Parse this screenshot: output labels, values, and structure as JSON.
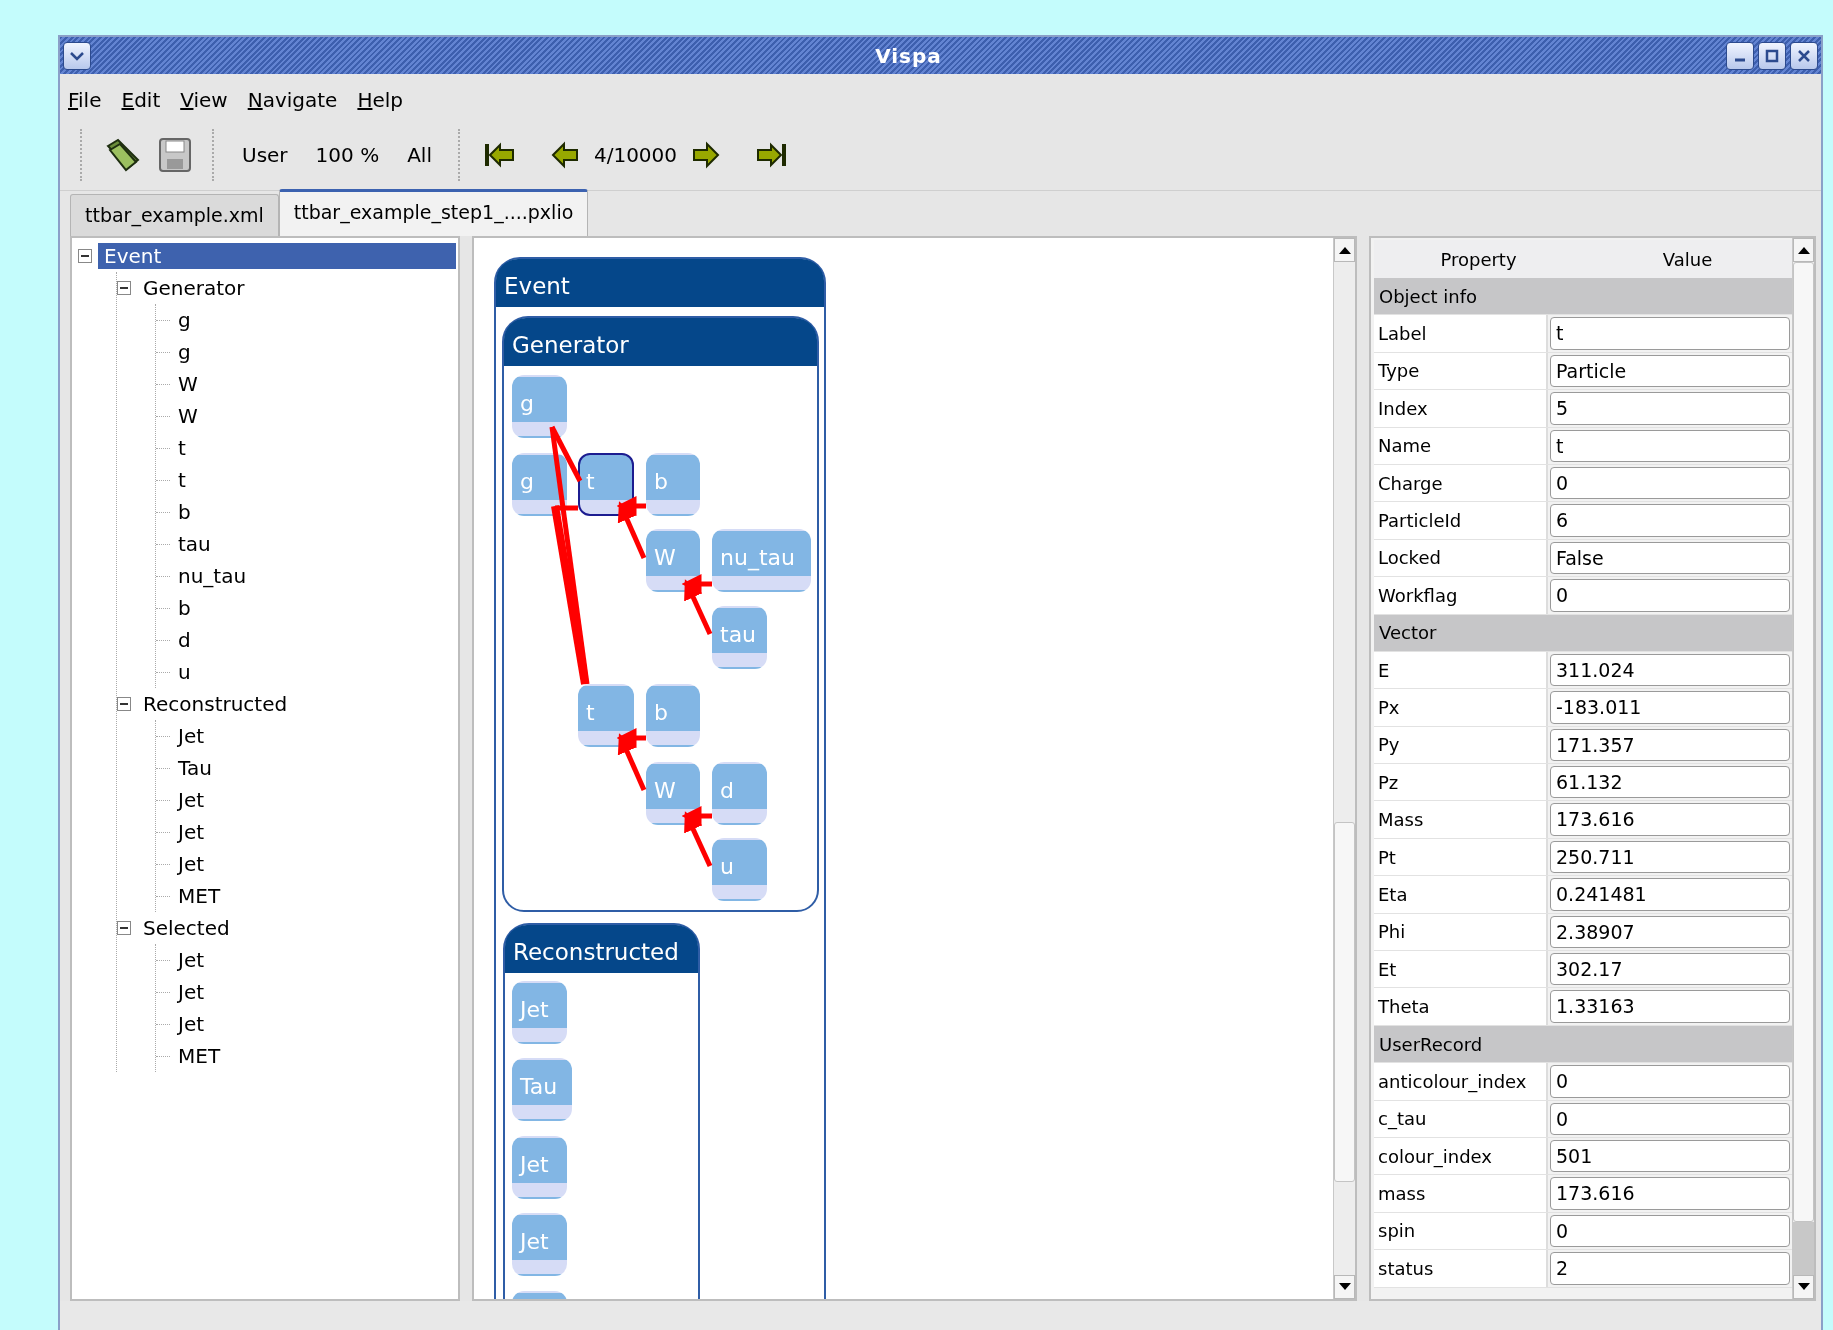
{
  "window": {
    "title": "Vispa"
  },
  "menu": [
    {
      "label": "File"
    },
    {
      "label": "Edit"
    },
    {
      "label": "View"
    },
    {
      "label": "Navigate"
    },
    {
      "label": "Help"
    }
  ],
  "toolbar": {
    "view_mode": "User",
    "zoom": "100 %",
    "filter": "All",
    "event_counter": "4/10000"
  },
  "tabs": [
    {
      "label": "ttbar_example.xml",
      "selected": false
    },
    {
      "label": "ttbar_example_step1_....pxlio",
      "selected": true
    }
  ],
  "tree": {
    "label": "Event",
    "selected": true,
    "expanded": true,
    "children": [
      {
        "label": "Generator",
        "selected": false,
        "expanded": true,
        "children": [
          {
            "label": "g",
            "selected": false
          },
          {
            "label": "g",
            "selected": false
          },
          {
            "label": "W",
            "selected": false
          },
          {
            "label": "W",
            "selected": false
          },
          {
            "label": "t",
            "selected": false
          },
          {
            "label": "t",
            "selected": false
          },
          {
            "label": "b",
            "selected": false
          },
          {
            "label": "tau",
            "selected": false
          },
          {
            "label": "nu_tau",
            "selected": false
          },
          {
            "label": "b",
            "selected": false
          },
          {
            "label": "d",
            "selected": false
          },
          {
            "label": "u",
            "selected": false
          }
        ]
      },
      {
        "label": "Reconstructed",
        "selected": false,
        "expanded": true,
        "children": [
          {
            "label": "Jet",
            "selected": false
          },
          {
            "label": "Tau",
            "selected": false
          },
          {
            "label": "Jet",
            "selected": false
          },
          {
            "label": "Jet",
            "selected": false
          },
          {
            "label": "Jet",
            "selected": false
          },
          {
            "label": "MET",
            "selected": false
          }
        ]
      },
      {
        "label": "Selected",
        "selected": false,
        "expanded": true,
        "children": [
          {
            "label": "Jet",
            "selected": false
          },
          {
            "label": "Jet",
            "selected": false
          },
          {
            "label": "Jet",
            "selected": false
          },
          {
            "label": "MET",
            "selected": false
          }
        ]
      }
    ]
  },
  "diagram": {
    "title": "Event",
    "groups": [
      {
        "title": "Generator",
        "nodes": [
          {
            "label": "g",
            "selected": false
          },
          {
            "label": "g",
            "selected": false
          },
          {
            "label": "t",
            "selected": true
          },
          {
            "label": "b",
            "selected": false
          },
          {
            "label": "W",
            "selected": false
          },
          {
            "label": "nu_tau",
            "selected": false
          },
          {
            "label": "tau",
            "selected": false
          },
          {
            "label": "t",
            "selected": false
          },
          {
            "label": "b",
            "selected": false
          },
          {
            "label": "W",
            "selected": false
          },
          {
            "label": "d",
            "selected": false
          },
          {
            "label": "u",
            "selected": false
          }
        ]
      },
      {
        "title": "Reconstructed",
        "nodes": [
          {
            "label": "Jet",
            "selected": false
          },
          {
            "label": "Tau",
            "selected": false
          },
          {
            "label": "Jet",
            "selected": false
          },
          {
            "label": "Jet",
            "selected": false
          }
        ]
      }
    ]
  },
  "properties": {
    "columns": [
      "Property",
      "Value"
    ],
    "rows": [
      {
        "kind": "section",
        "label": "Object info"
      },
      {
        "kind": "field",
        "label": "Label",
        "value": "t"
      },
      {
        "kind": "field",
        "label": "Type",
        "value": "Particle"
      },
      {
        "kind": "field",
        "label": "Index",
        "value": "5"
      },
      {
        "kind": "field",
        "label": "Name",
        "value": "t"
      },
      {
        "kind": "field",
        "label": "Charge",
        "value": "0"
      },
      {
        "kind": "field",
        "label": "ParticleId",
        "value": "6"
      },
      {
        "kind": "field",
        "label": "Locked",
        "value": "False"
      },
      {
        "kind": "field",
        "label": "Workflag",
        "value": "0"
      },
      {
        "kind": "section",
        "label": "Vector"
      },
      {
        "kind": "field",
        "label": "E",
        "value": "311.024"
      },
      {
        "kind": "field",
        "label": "Px",
        "value": "-183.011"
      },
      {
        "kind": "field",
        "label": "Py",
        "value": "171.357"
      },
      {
        "kind": "field",
        "label": "Pz",
        "value": "61.132"
      },
      {
        "kind": "field",
        "label": "Mass",
        "value": "173.616"
      },
      {
        "kind": "field",
        "label": "Pt",
        "value": "250.711"
      },
      {
        "kind": "field",
        "label": "Eta",
        "value": "0.241481"
      },
      {
        "kind": "field",
        "label": "Phi",
        "value": "2.38907"
      },
      {
        "kind": "field",
        "label": "Et",
        "value": "302.17"
      },
      {
        "kind": "field",
        "label": "Theta",
        "value": "1.33163"
      },
      {
        "kind": "section",
        "label": "UserRecord"
      },
      {
        "kind": "field",
        "label": "anticolour_index",
        "value": "0"
      },
      {
        "kind": "field",
        "label": "c_tau",
        "value": "0"
      },
      {
        "kind": "field",
        "label": "colour_index",
        "value": "501"
      },
      {
        "kind": "field",
        "label": "mass",
        "value": "173.616"
      },
      {
        "kind": "field",
        "label": "spin",
        "value": "0"
      },
      {
        "kind": "field",
        "label": "status",
        "value": "2"
      }
    ]
  }
}
